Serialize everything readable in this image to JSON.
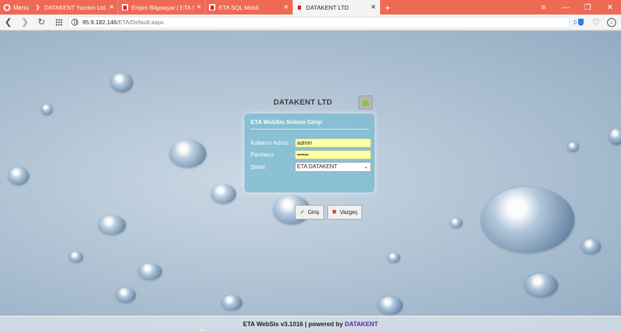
{
  "browser": {
    "menu_label": "Menu",
    "tabs": [
      {
        "label": "DATAKENT Yazılım Ltd. Şti.",
        "active": false
      },
      {
        "label": "Erişim Bilgisayar | ETA SQL",
        "active": false
      },
      {
        "label": "ETA SQL Mobil",
        "active": false
      },
      {
        "label": "DATAKENT LTD",
        "active": true
      }
    ],
    "new_tab_label": "+",
    "url_host": "95.9.182.146",
    "url_path": "/ETA/Default.aspx",
    "blocked_count": "0"
  },
  "login": {
    "company_name": "DATAKENT LTD",
    "panel_title": "ETA WebSis Sistem Girişi",
    "username_label": "Kullanıcı Adınız",
    "username_value": "admin",
    "password_label": "Parolanız",
    "password_value": "••••••",
    "company_label": "Şirket",
    "company_selected": "ETA DATAKENT",
    "colon": ":",
    "login_button": "Giriş",
    "cancel_button": "Vazgeç"
  },
  "footer": {
    "text": "ETA WebSis v3.1016 | powered by ",
    "brand": "DATAKENT"
  },
  "colors": {
    "tab_strip": "#ee6a55",
    "panel": "#7ebcd2",
    "input_fill": "#ffffa6",
    "footer_brand": "#5a2aa0"
  }
}
